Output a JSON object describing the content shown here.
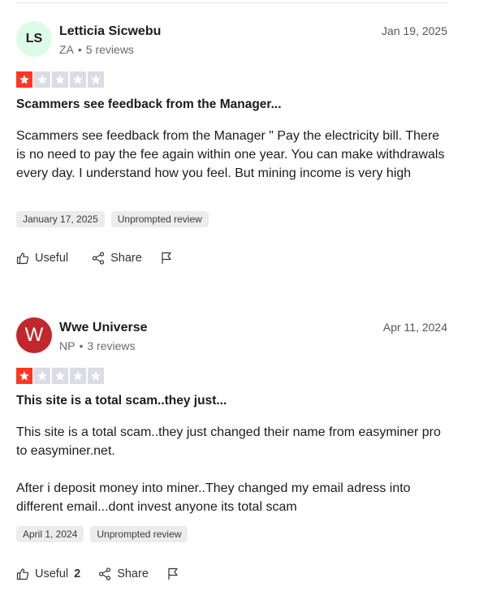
{
  "reviews": [
    {
      "avatar_initials": "LS",
      "name": "Letticia Sicwebu",
      "country": "ZA",
      "review_count": "5 reviews",
      "date": "Jan 19, 2025",
      "rating": 1,
      "title": "Scammers see feedback from the Manager...",
      "body": [
        "Scammers see feedback from the Manager \" Pay the electricity bill. There is no need to pay the fee again within one year. You can make withdrawals every day. I understand how you feel. But mining income is very high"
      ],
      "experience_date": "January 17, 2025",
      "tag": "Unprompted review",
      "useful_label": "Useful",
      "useful_count": "",
      "share_label": "Share"
    },
    {
      "avatar_initials": "W",
      "name": "Wwe Universe",
      "country": "NP",
      "review_count": "3 reviews",
      "date": "Apr 11, 2024",
      "rating": 1,
      "title": "This site is a total scam..they just...",
      "body": [
        "This site is a total scam..they just changed their name from easyminer pro to easyminer.net.",
        "After i deposit money into miner..They changed my email adress into different email...dont invest anyone its total scam"
      ],
      "experience_date": "April 1, 2024",
      "tag": "Unprompted review",
      "useful_label": "Useful",
      "useful_count": "2",
      "share_label": "Share"
    }
  ],
  "meta_separator": "•",
  "colors": {
    "star_active": "#ff3722",
    "star_inactive": "#dcdce6",
    "avatar_red": "#c1272d",
    "avatar_light": "#dcfce7"
  },
  "icons": {
    "star": "star-icon",
    "useful": "thumbs-up-icon",
    "share": "share-icon",
    "report": "flag-icon"
  }
}
